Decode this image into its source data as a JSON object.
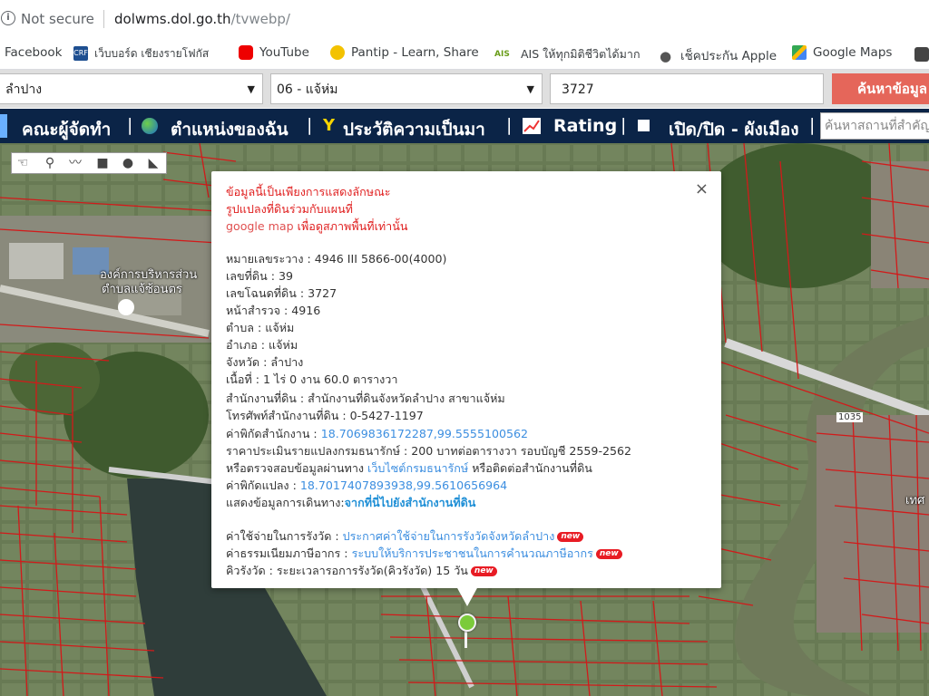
{
  "browser": {
    "security_label": "Not secure",
    "url_host": "dolwms.dol.go.th",
    "url_path": "/tvwebp/"
  },
  "bookmarks": [
    {
      "label": "Facebook",
      "icon": "facebook-icon"
    },
    {
      "label": "เว็บบอร์ด เชียงรายโฟกัส",
      "icon": "crf-icon"
    },
    {
      "label": "YouTube",
      "icon": "youtube-icon"
    },
    {
      "label": "Pantip - Learn, Share",
      "icon": "pantip-icon"
    },
    {
      "label": "AIS ให้ทุกมิติชีวิตได้มาก",
      "icon": "ais-icon"
    },
    {
      "label": "เช็คประกัน Apple",
      "icon": "apple-icon"
    },
    {
      "label": "Google Maps",
      "icon": "google-maps-icon"
    }
  ],
  "search": {
    "province": "ลำปาง",
    "district": "06 - แจ้ห่ม",
    "parcel_number": "3727",
    "button_label": "ค้นหาข้อมูล"
  },
  "nav": {
    "item1": "คณะผู้จัดทำ",
    "item2": "ตำแหน่งของฉัน",
    "item3": "ประวัติความเป็นมา",
    "item4": "Rating",
    "item5": "เปิด/ปิด - ผังเมือง",
    "place_search_placeholder": "ค้นหาสถานที่สำคัญ"
  },
  "map_labels": {
    "top_left_1": "องค์การบริหารส่วน",
    "top_left_2": "ตำบลแจ้ซ้อนตร",
    "road_label": "1035",
    "right_label": "เทศ"
  },
  "popup": {
    "warn1": "ข้อมูลนี้เป็นเพียงการแสดงลักษณะ",
    "warn2": "รูปแปลงที่ดินร่วมกับแผนที่",
    "warn3_gm": "google map",
    "warn3_rest": " เพื่อดูสภาพพื้นที่เท่านั้น",
    "sheet": "หมายเลขระวาง : 4946 III 5866-00(4000)",
    "land_no": "เลขที่ดิน : 39",
    "deed_no": "เลขโฉนดที่ดิน : 3727",
    "survey_page": "หน้าสำรวจ : 4916",
    "tambon": "ตำบล : แจ้ห่ม",
    "amphoe": "อำเภอ : แจ้ห่ม",
    "province": "จังหวัด : ลำปาง",
    "area": "เนื้อที่ : 1 ไร่ 0 งาน 60.0 ตารางวา",
    "office": "สำนักงานที่ดิน : สำนักงานที่ดินจังหวัดลำปาง สาขาแจ้ห่ม",
    "phone": "โทรศัพท์สำนักงานที่ดิน : 0-5427-1197",
    "office_coord_label": "ค่าพิกัดสำนักงาน : ",
    "office_coord": "18.7069836172287,99.5555100562",
    "price": "ราคาประเมินรายแปลงกรมธนารักษ์ : 200 บาทต่อตารางวา รอบบัญชี 2559-2562",
    "verify_pre": "หรือตรวจสอบข้อมูลผ่านทาง ",
    "verify_link": "เว็บไซต์กรมธนารักษ์",
    "verify_post": " หรือติดต่อสำนักงานที่ดิน",
    "parcel_coord_label": "ค่าพิกัดแปลง : ",
    "parcel_coord": "18.7017407893938,99.5610656964",
    "route_pre": "แสดงข้อมูลการเดินทาง:",
    "route_link": "จากที่นี่ไปยังสำนักงานที่ดิน",
    "fee_pre": "ค่าใช้จ่ายในการรังวัด : ",
    "fee_link": "ประกาศค่าใช้จ่ายในการรังวัดจังหวัดลำปาง",
    "tax_pre": "ค่าธรรมเนียมภาษีอากร : ",
    "tax_link": "ระบบให้บริการประชาชนในการคำนวณภาษีอากร",
    "queue": "คิวรังวัด : ระยะเวลารอการรังวัด(คิวรังวัด) 15 วัน",
    "new_badge": "new",
    "close": "×"
  }
}
